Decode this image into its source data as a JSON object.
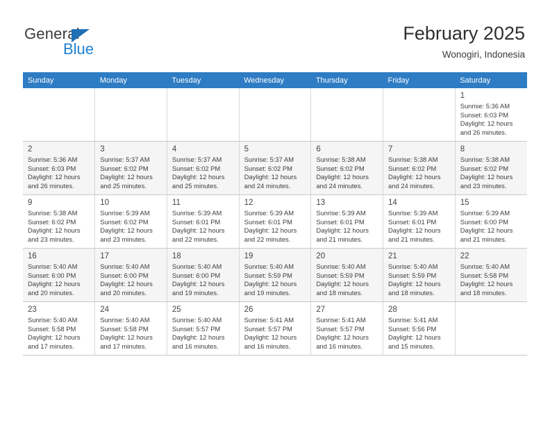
{
  "brand": {
    "name_top": "General",
    "name_bottom": "Blue",
    "accent_color": "#1f7fd0",
    "triangle_color": "#1f6fb5",
    "triangle_icon": "triangle-icon"
  },
  "header": {
    "title": "February 2025",
    "subtitle": "Wonogiri, Indonesia"
  },
  "calendar": {
    "header_bg": "#2e7cc3",
    "header_text_color": "#ffffff",
    "weekdays": [
      "Sunday",
      "Monday",
      "Tuesday",
      "Wednesday",
      "Thursday",
      "Friday",
      "Saturday"
    ],
    "weeks": [
      [
        {
          "day": "",
          "l1": "",
          "l2": "",
          "l3": "",
          "l4": ""
        },
        {
          "day": "",
          "l1": "",
          "l2": "",
          "l3": "",
          "l4": ""
        },
        {
          "day": "",
          "l1": "",
          "l2": "",
          "l3": "",
          "l4": ""
        },
        {
          "day": "",
          "l1": "",
          "l2": "",
          "l3": "",
          "l4": ""
        },
        {
          "day": "",
          "l1": "",
          "l2": "",
          "l3": "",
          "l4": ""
        },
        {
          "day": "",
          "l1": "",
          "l2": "",
          "l3": "",
          "l4": ""
        },
        {
          "day": "1",
          "l1": "Sunrise: 5:36 AM",
          "l2": "Sunset: 6:03 PM",
          "l3": "Daylight: 12 hours",
          "l4": "and 26 minutes."
        }
      ],
      [
        {
          "day": "2",
          "l1": "Sunrise: 5:36 AM",
          "l2": "Sunset: 6:03 PM",
          "l3": "Daylight: 12 hours",
          "l4": "and 26 minutes."
        },
        {
          "day": "3",
          "l1": "Sunrise: 5:37 AM",
          "l2": "Sunset: 6:02 PM",
          "l3": "Daylight: 12 hours",
          "l4": "and 25 minutes."
        },
        {
          "day": "4",
          "l1": "Sunrise: 5:37 AM",
          "l2": "Sunset: 6:02 PM",
          "l3": "Daylight: 12 hours",
          "l4": "and 25 minutes."
        },
        {
          "day": "5",
          "l1": "Sunrise: 5:37 AM",
          "l2": "Sunset: 6:02 PM",
          "l3": "Daylight: 12 hours",
          "l4": "and 24 minutes."
        },
        {
          "day": "6",
          "l1": "Sunrise: 5:38 AM",
          "l2": "Sunset: 6:02 PM",
          "l3": "Daylight: 12 hours",
          "l4": "and 24 minutes."
        },
        {
          "day": "7",
          "l1": "Sunrise: 5:38 AM",
          "l2": "Sunset: 6:02 PM",
          "l3": "Daylight: 12 hours",
          "l4": "and 24 minutes."
        },
        {
          "day": "8",
          "l1": "Sunrise: 5:38 AM",
          "l2": "Sunset: 6:02 PM",
          "l3": "Daylight: 12 hours",
          "l4": "and 23 minutes."
        }
      ],
      [
        {
          "day": "9",
          "l1": "Sunrise: 5:38 AM",
          "l2": "Sunset: 6:02 PM",
          "l3": "Daylight: 12 hours",
          "l4": "and 23 minutes."
        },
        {
          "day": "10",
          "l1": "Sunrise: 5:39 AM",
          "l2": "Sunset: 6:02 PM",
          "l3": "Daylight: 12 hours",
          "l4": "and 23 minutes."
        },
        {
          "day": "11",
          "l1": "Sunrise: 5:39 AM",
          "l2": "Sunset: 6:01 PM",
          "l3": "Daylight: 12 hours",
          "l4": "and 22 minutes."
        },
        {
          "day": "12",
          "l1": "Sunrise: 5:39 AM",
          "l2": "Sunset: 6:01 PM",
          "l3": "Daylight: 12 hours",
          "l4": "and 22 minutes."
        },
        {
          "day": "13",
          "l1": "Sunrise: 5:39 AM",
          "l2": "Sunset: 6:01 PM",
          "l3": "Daylight: 12 hours",
          "l4": "and 21 minutes."
        },
        {
          "day": "14",
          "l1": "Sunrise: 5:39 AM",
          "l2": "Sunset: 6:01 PM",
          "l3": "Daylight: 12 hours",
          "l4": "and 21 minutes."
        },
        {
          "day": "15",
          "l1": "Sunrise: 5:39 AM",
          "l2": "Sunset: 6:00 PM",
          "l3": "Daylight: 12 hours",
          "l4": "and 21 minutes."
        }
      ],
      [
        {
          "day": "16",
          "l1": "Sunrise: 5:40 AM",
          "l2": "Sunset: 6:00 PM",
          "l3": "Daylight: 12 hours",
          "l4": "and 20 minutes."
        },
        {
          "day": "17",
          "l1": "Sunrise: 5:40 AM",
          "l2": "Sunset: 6:00 PM",
          "l3": "Daylight: 12 hours",
          "l4": "and 20 minutes."
        },
        {
          "day": "18",
          "l1": "Sunrise: 5:40 AM",
          "l2": "Sunset: 6:00 PM",
          "l3": "Daylight: 12 hours",
          "l4": "and 19 minutes."
        },
        {
          "day": "19",
          "l1": "Sunrise: 5:40 AM",
          "l2": "Sunset: 5:59 PM",
          "l3": "Daylight: 12 hours",
          "l4": "and 19 minutes."
        },
        {
          "day": "20",
          "l1": "Sunrise: 5:40 AM",
          "l2": "Sunset: 5:59 PM",
          "l3": "Daylight: 12 hours",
          "l4": "and 18 minutes."
        },
        {
          "day": "21",
          "l1": "Sunrise: 5:40 AM",
          "l2": "Sunset: 5:59 PM",
          "l3": "Daylight: 12 hours",
          "l4": "and 18 minutes."
        },
        {
          "day": "22",
          "l1": "Sunrise: 5:40 AM",
          "l2": "Sunset: 5:58 PM",
          "l3": "Daylight: 12 hours",
          "l4": "and 18 minutes."
        }
      ],
      [
        {
          "day": "23",
          "l1": "Sunrise: 5:40 AM",
          "l2": "Sunset: 5:58 PM",
          "l3": "Daylight: 12 hours",
          "l4": "and 17 minutes."
        },
        {
          "day": "24",
          "l1": "Sunrise: 5:40 AM",
          "l2": "Sunset: 5:58 PM",
          "l3": "Daylight: 12 hours",
          "l4": "and 17 minutes."
        },
        {
          "day": "25",
          "l1": "Sunrise: 5:40 AM",
          "l2": "Sunset: 5:57 PM",
          "l3": "Daylight: 12 hours",
          "l4": "and 16 minutes."
        },
        {
          "day": "26",
          "l1": "Sunrise: 5:41 AM",
          "l2": "Sunset: 5:57 PM",
          "l3": "Daylight: 12 hours",
          "l4": "and 16 minutes."
        },
        {
          "day": "27",
          "l1": "Sunrise: 5:41 AM",
          "l2": "Sunset: 5:57 PM",
          "l3": "Daylight: 12 hours",
          "l4": "and 16 minutes."
        },
        {
          "day": "28",
          "l1": "Sunrise: 5:41 AM",
          "l2": "Sunset: 5:56 PM",
          "l3": "Daylight: 12 hours",
          "l4": "and 15 minutes."
        },
        {
          "day": "",
          "l1": "",
          "l2": "",
          "l3": "",
          "l4": ""
        }
      ]
    ]
  }
}
